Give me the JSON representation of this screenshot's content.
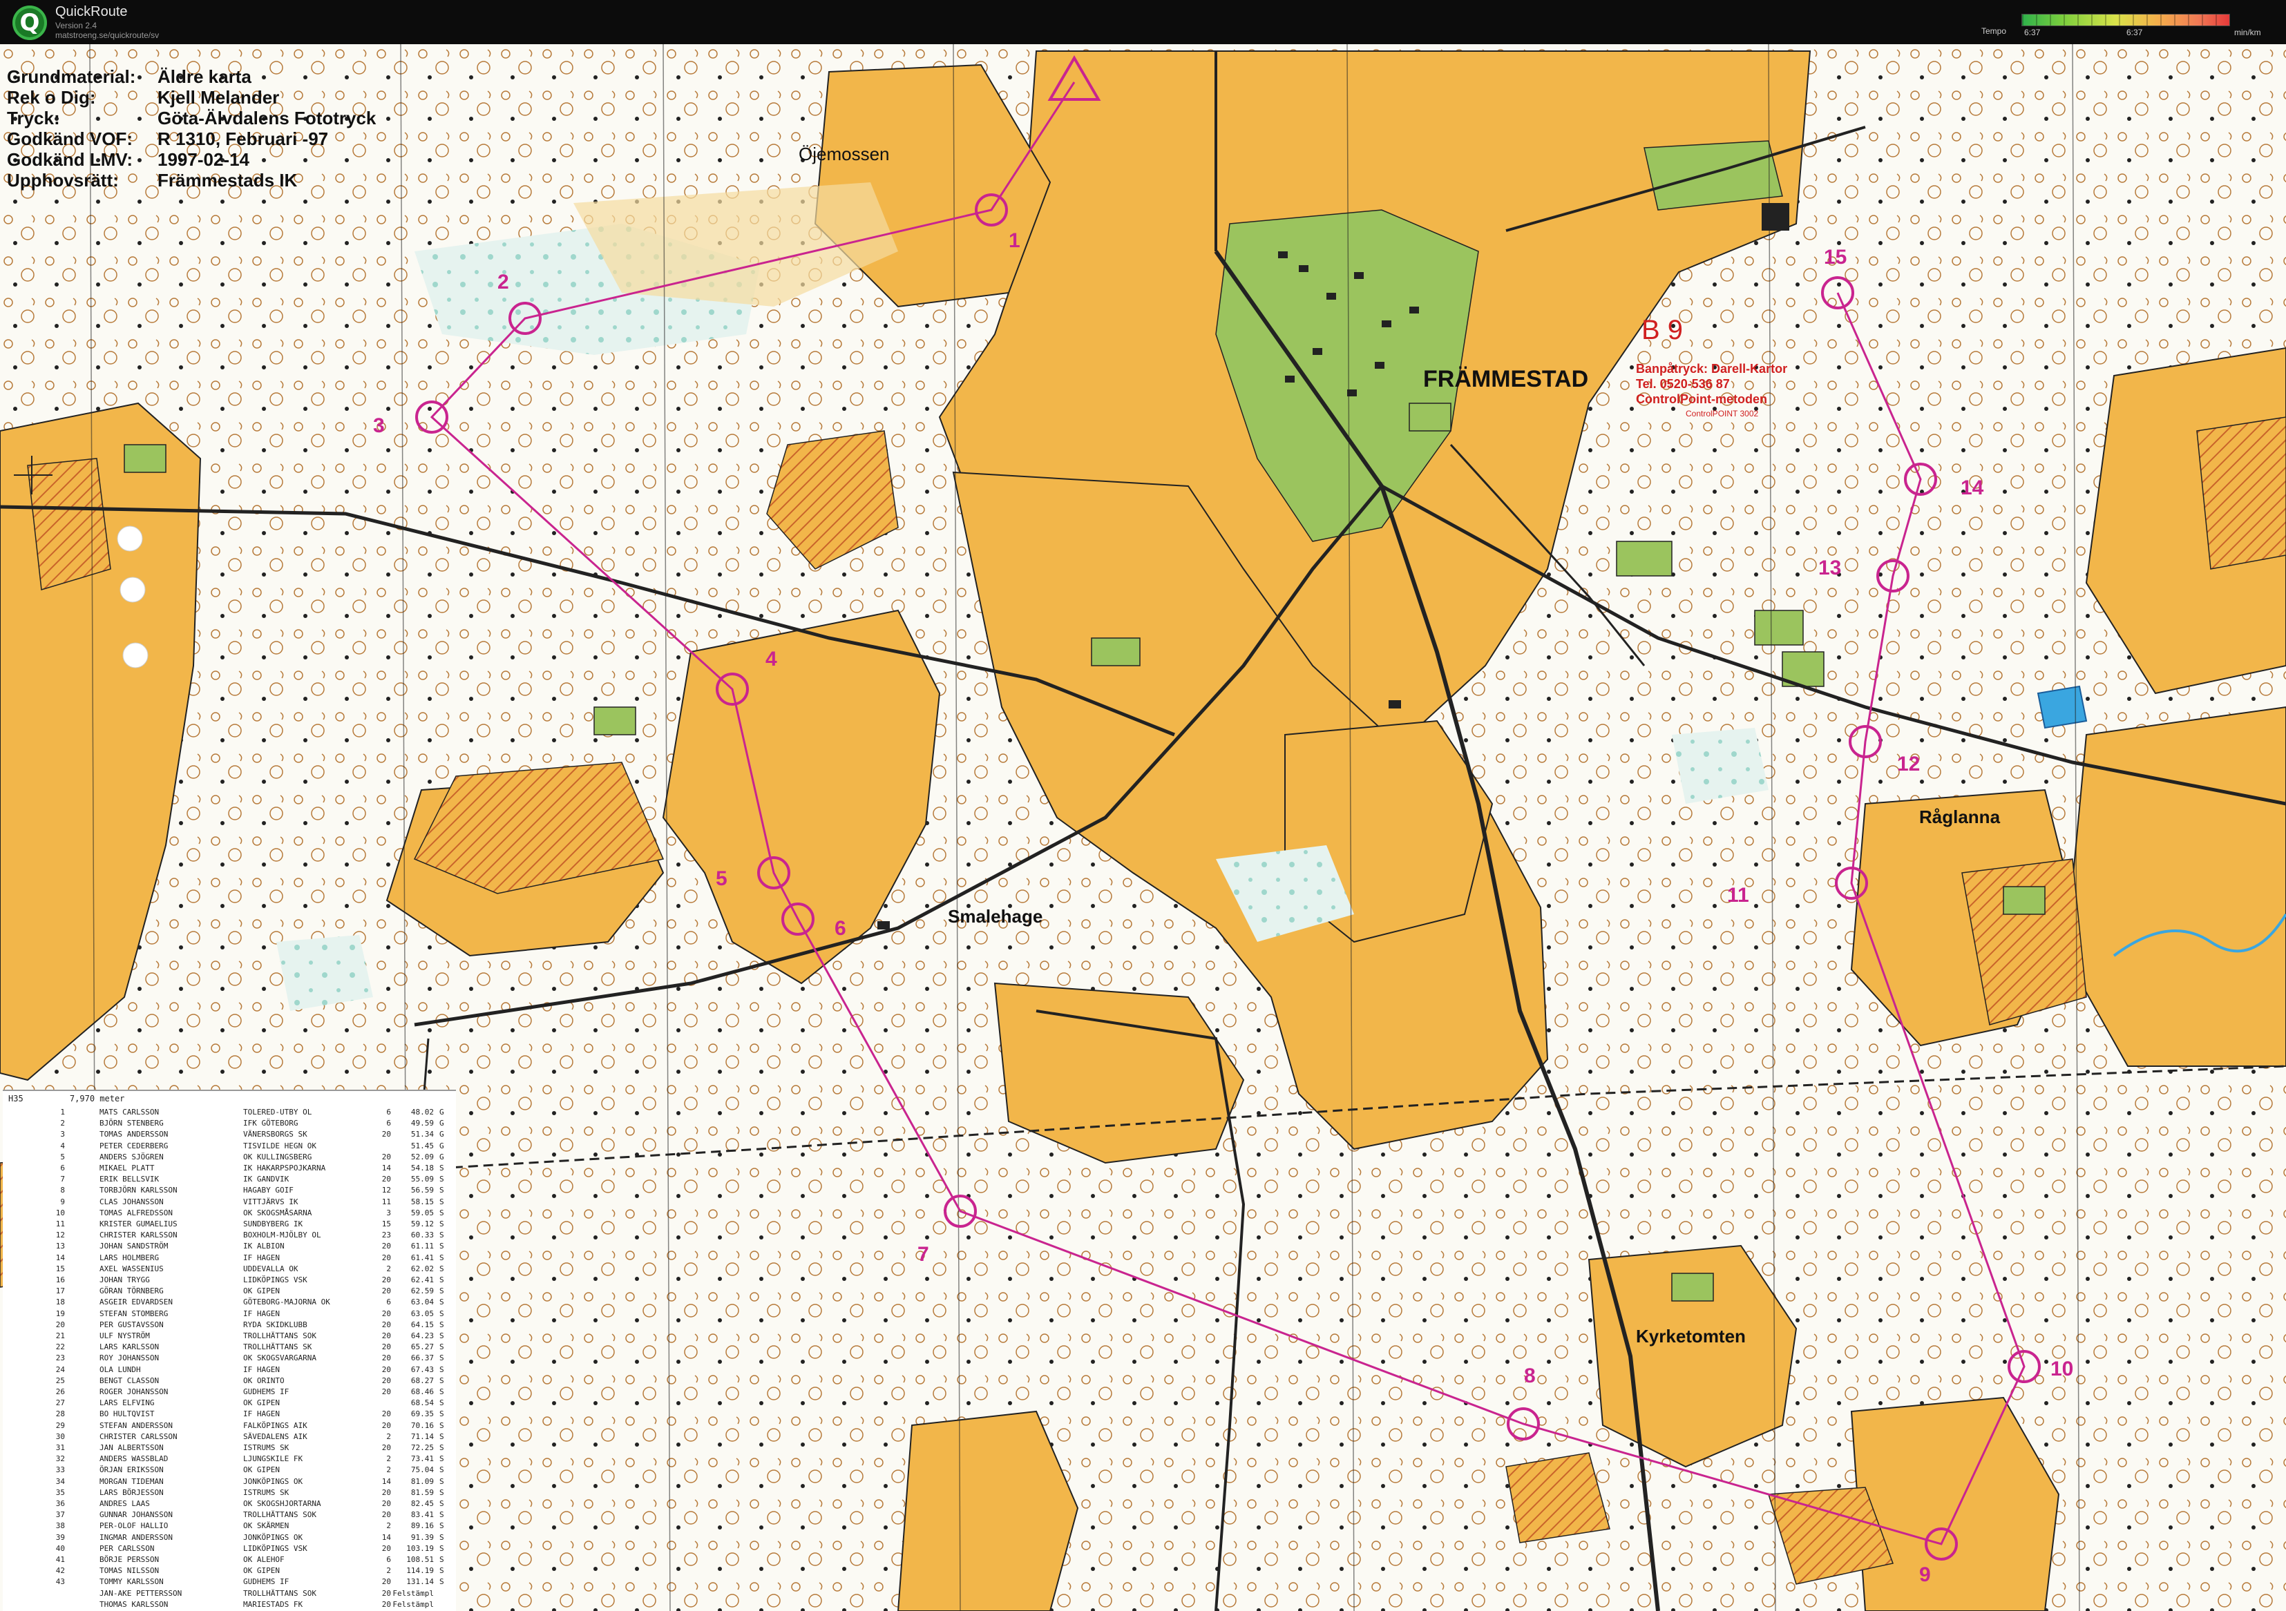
{
  "app": {
    "name": "QuickRoute",
    "version": "Version 2.4",
    "url": "matstroeng.se/quickroute/sv"
  },
  "legend": {
    "title": "Tempo",
    "min_value": "6:37",
    "mid_value": "6:37",
    "unit": "min/km",
    "colors": [
      "#2fb14b",
      "#7dcf3d",
      "#d9e34a",
      "#f4b04b",
      "#f07a55",
      "#e63a3a"
    ]
  },
  "map_info": [
    {
      "key": "Grundmaterial:",
      "value": "Äldre karta"
    },
    {
      "key": "Rek o Dig:",
      "value": "Kjell Melander"
    },
    {
      "key": "Tryck:",
      "value": "Göta-Älvdalens Fototryck"
    },
    {
      "key": "Godkänd VOF:",
      "value": "R 1310, Februari -97"
    },
    {
      "key": "Godkänd LMV:",
      "value": "1997-02-14"
    },
    {
      "key": "Upphovsrätt:",
      "value": "Främmestads IK"
    }
  ],
  "places": {
    "ojemossen": "Öjemossen",
    "frammestad": "FRÄMMESTAD",
    "smalehage": "Smalehage",
    "raglanna": "Råglanna",
    "kyrketomten": "Kyrketomten"
  },
  "course_banner": {
    "code": "B 9",
    "line1": "Banpåtryck: Darell-Kartor",
    "line2": "Tel. 0520-536 87",
    "line3": "ControlPoint-metoden",
    "line4": "ControlPOINT 3002"
  },
  "controls": [
    "1",
    "2",
    "3",
    "4",
    "5",
    "6",
    "7",
    "8",
    "9",
    "10",
    "11",
    "12",
    "13",
    "14",
    "15"
  ],
  "results": {
    "class": "H35",
    "distance": "7,970 meter",
    "rows": [
      {
        "pos": "1",
        "name": "MATS CARLSSON",
        "club": "TOLERED-UTBY OL",
        "age": "6",
        "time": "48.02",
        "st": "G"
      },
      {
        "pos": "2",
        "name": "BJÖRN STENBERG",
        "club": "IFK GÖTEBORG",
        "age": "6",
        "time": "49.59",
        "st": "G"
      },
      {
        "pos": "3",
        "name": "TOMAS ANDERSSON",
        "club": "VÄNERSBORGS SK",
        "age": "20",
        "time": "51.34",
        "st": "G"
      },
      {
        "pos": "4",
        "name": "PETER CEDERBERG",
        "club": "TISVILDE HEGN OK",
        "age": "",
        "time": "51.45",
        "st": "G"
      },
      {
        "pos": "5",
        "name": "ANDERS SJÖGREN",
        "club": "OK KULLINGSBERG",
        "age": "20",
        "time": "52.09",
        "st": "G"
      },
      {
        "pos": "6",
        "name": "MIKAEL PLATT",
        "club": "IK HAKARPSPOJKARNA",
        "age": "14",
        "time": "54.18",
        "st": "S"
      },
      {
        "pos": "7",
        "name": "ERIK BELLSVIK",
        "club": "IK GANDVIK",
        "age": "20",
        "time": "55.09",
        "st": "S"
      },
      {
        "pos": "8",
        "name": "TORBJÖRN KARLSSON",
        "club": "HAGABY GOIF",
        "age": "12",
        "time": "56.59",
        "st": "S"
      },
      {
        "pos": "9",
        "name": "CLAS JOHANSSON",
        "club": "VITTJÄRVS IK",
        "age": "11",
        "time": "58.15",
        "st": "S"
      },
      {
        "pos": "10",
        "name": "TOMAS ALFREDSSON",
        "club": "OK SKOGSMÅSARNA",
        "age": "3",
        "time": "59.05",
        "st": "S"
      },
      {
        "pos": "11",
        "name": "KRISTER GUMAELIUS",
        "club": "SUNDBYBERG IK",
        "age": "15",
        "time": "59.12",
        "st": "S"
      },
      {
        "pos": "12",
        "name": "CHRISTER KARLSSON",
        "club": "BOXHOLM-MJÖLBY OL",
        "age": "23",
        "time": "60.33",
        "st": "S"
      },
      {
        "pos": "13",
        "name": "JOHAN SANDSTRÖM",
        "club": "IK ALBION",
        "age": "20",
        "time": "61.11",
        "st": "S"
      },
      {
        "pos": "14",
        "name": "LARS HOLMBERG",
        "club": "IF HAGEN",
        "age": "20",
        "time": "61.41",
        "st": "S"
      },
      {
        "pos": "15",
        "name": "AXEL WASSENIUS",
        "club": "UDDEVALLA OK",
        "age": "2",
        "time": "62.02",
        "st": "S"
      },
      {
        "pos": "16",
        "name": "JOHAN TRYGG",
        "club": "LIDKÖPINGS VSK",
        "age": "20",
        "time": "62.41",
        "st": "S"
      },
      {
        "pos": "17",
        "name": "GÖRAN TÖRNBERG",
        "club": "OK GIPEN",
        "age": "20",
        "time": "62.59",
        "st": "S"
      },
      {
        "pos": "18",
        "name": "ASGEIR EDVARDSEN",
        "club": "GÖTEBORG-MAJORNA OK",
        "age": "6",
        "time": "63.04",
        "st": "S"
      },
      {
        "pos": "19",
        "name": "STEFAN STOMBERG",
        "club": "IF HAGEN",
        "age": "20",
        "time": "63.05",
        "st": "S"
      },
      {
        "pos": "20",
        "name": "PER GUSTAVSSON",
        "club": "RYDA SKIDKLUBB",
        "age": "20",
        "time": "64.15",
        "st": "S"
      },
      {
        "pos": "21",
        "name": "ULF NYSTRÖM",
        "club": "TROLLHÄTTANS SOK",
        "age": "20",
        "time": "64.23",
        "st": "S"
      },
      {
        "pos": "22",
        "name": "LARS KARLSSON",
        "club": "TROLLHÄTTANS SK",
        "age": "20",
        "time": "65.27",
        "st": "S"
      },
      {
        "pos": "23",
        "name": "ROY JOHANSSON",
        "club": "OK SKOGSVARGARNA",
        "age": "20",
        "time": "66.37",
        "st": "S"
      },
      {
        "pos": "24",
        "name": "OLA LUNDH",
        "club": "IF HAGEN",
        "age": "20",
        "time": "67.43",
        "st": "S"
      },
      {
        "pos": "25",
        "name": "BENGT CLASSON",
        "club": "OK ORINTO",
        "age": "20",
        "time": "68.27",
        "st": "S"
      },
      {
        "pos": "26",
        "name": "ROGER JOHANSSON",
        "club": "GUDHEMS IF",
        "age": "20",
        "time": "68.46",
        "st": "S"
      },
      {
        "pos": "27",
        "name": "LARS ELFVING",
        "club": "OK GIPEN",
        "age": "",
        "time": "68.54",
        "st": "S"
      },
      {
        "pos": "28",
        "name": "BO HULTQVIST",
        "club": "IF HAGEN",
        "age": "20",
        "time": "69.35",
        "st": "S"
      },
      {
        "pos": "29",
        "name": "STEFAN ANDERSSON",
        "club": "FALKÖPINGS AIK",
        "age": "20",
        "time": "70.16",
        "st": "S"
      },
      {
        "pos": "30",
        "name": "CHRISTER CARLSSON",
        "club": "SÄVEDALENS AIK",
        "age": "2",
        "time": "71.14",
        "st": "S"
      },
      {
        "pos": "31",
        "name": "JAN ALBERTSSON",
        "club": "ISTRUMS SK",
        "age": "20",
        "time": "72.25",
        "st": "S"
      },
      {
        "pos": "32",
        "name": "ANDERS WASSBLAD",
        "club": "LJUNGSKILE FK",
        "age": "2",
        "time": "73.41",
        "st": "S"
      },
      {
        "pos": "33",
        "name": "ÖRJAN ERIKSSON",
        "club": "OK GIPEN",
        "age": "2",
        "time": "75.04",
        "st": "S"
      },
      {
        "pos": "34",
        "name": "MORGAN TIDEMAN",
        "club": "JONKÖPINGS OK",
        "age": "14",
        "time": "81.09",
        "st": "S"
      },
      {
        "pos": "35",
        "name": "LARS BÖRJESSON",
        "club": "ISTRUMS SK",
        "age": "20",
        "time": "81.59",
        "st": "S"
      },
      {
        "pos": "36",
        "name": "ANDRES LAAS",
        "club": "OK SKOGSHJORTARNA",
        "age": "20",
        "time": "82.45",
        "st": "S"
      },
      {
        "pos": "37",
        "name": "GUNNAR JOHANSSON",
        "club": "TROLLHÄTTANS SOK",
        "age": "20",
        "time": "83.41",
        "st": "S"
      },
      {
        "pos": "38",
        "name": "PER-OLOF HALLIO",
        "club": "OK SKÄRMEN",
        "age": "2",
        "time": "89.16",
        "st": "S"
      },
      {
        "pos": "39",
        "name": "INGMAR ANDERSSON",
        "club": "JONKÖPINGS OK",
        "age": "14",
        "time": "91.39",
        "st": "S"
      },
      {
        "pos": "40",
        "name": "PER CARLSSON",
        "club": "LIDKÖPINGS VSK",
        "age": "20",
        "time": "103.19",
        "st": "S"
      },
      {
        "pos": "41",
        "name": "BÖRJE PERSSON",
        "club": "OK ALEHOF",
        "age": "6",
        "time": "108.51",
        "st": "S"
      },
      {
        "pos": "42",
        "name": "TOMAS NILSSON",
        "club": "OK GIPEN",
        "age": "2",
        "time": "114.19",
        "st": "S"
      },
      {
        "pos": "43",
        "name": "TOMMY KARLSSON",
        "club": "GUDHEMS IF",
        "age": "20",
        "time": "131.14",
        "st": "S"
      },
      {
        "pos": "",
        "name": "JAN-AKE PETTERSSON",
        "club": "TROLLHÄTTANS SOK",
        "age": "20",
        "time": "Felstämpl",
        "st": ""
      },
      {
        "pos": "",
        "name": "THOMAS KARLSSON",
        "club": "MARIESTADS FK",
        "age": "20",
        "time": "Felstämpl",
        "st": ""
      }
    ]
  }
}
